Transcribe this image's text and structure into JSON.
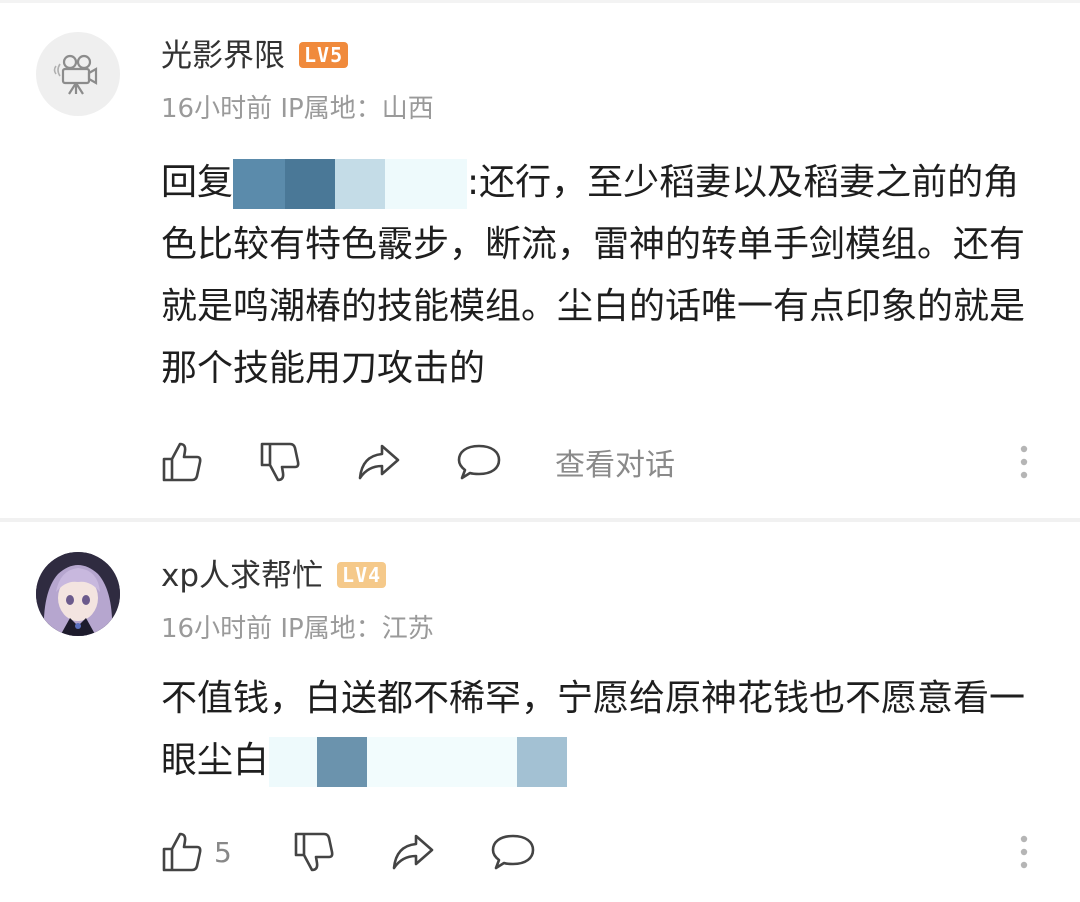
{
  "comments": [
    {
      "username": "光影界限",
      "level": "LV5",
      "time": "16小时前",
      "ip": "IP属地：山西",
      "reply_prefix": "回复",
      "text": ":还行，至少稻妻以及稻妻之前的角色比较有特色霰步，断流，雷神的转单手剑模组。还有就是鸣潮椿的技能模组。尘白的话唯一有点印象的就是那个技能用刀攻击的",
      "actions": {
        "view_conversation": "查看对话"
      },
      "redaction_colors": [
        "#5b8bab",
        "#4a7897",
        "#c4dce7",
        "#eefafc"
      ]
    },
    {
      "username": "xp人求帮忙",
      "level": "LV4",
      "time": "16小时前",
      "ip": "IP属地：江苏",
      "text": "不值钱，白送都不稀罕，宁愿给原神花钱也不愿意看一眼尘白",
      "like_count": "5",
      "redaction_colors": [
        "#eefafc",
        "#6b93ad",
        "#f2fcfd",
        "#a3c1d3"
      ]
    }
  ]
}
